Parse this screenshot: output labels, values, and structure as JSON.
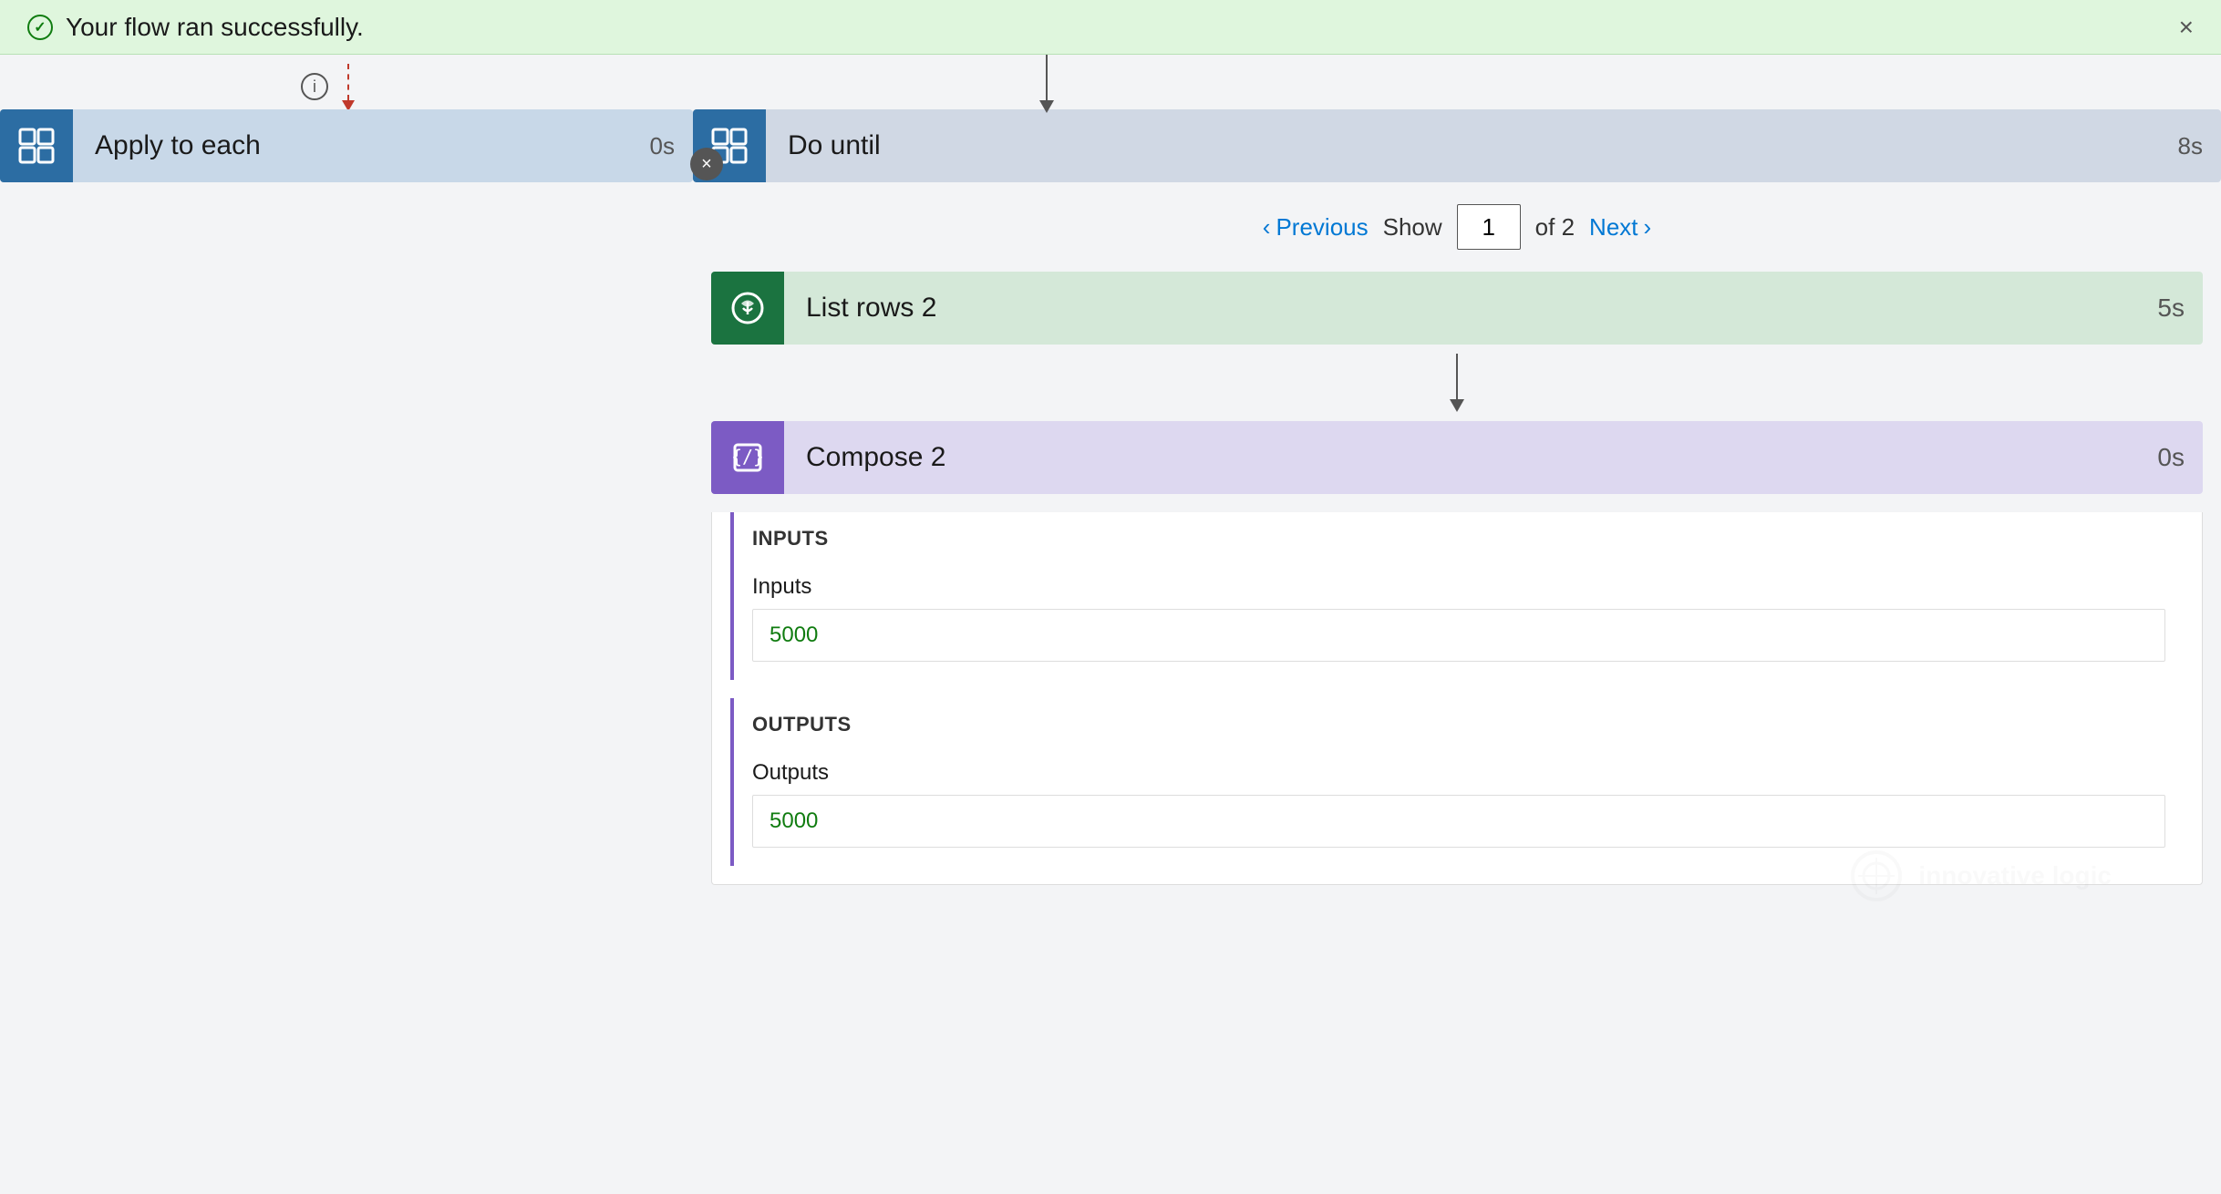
{
  "banner": {
    "message": "Your flow ran successfully.",
    "close_label": "×"
  },
  "left_panel": {
    "step": {
      "name": "Apply to each",
      "duration": "0s",
      "icon_color": "#2c6da3"
    }
  },
  "right_panel": {
    "step": {
      "name": "Do until",
      "duration": "8s",
      "icon_color": "#2c6da3"
    },
    "pagination": {
      "previous_label": "Previous",
      "current_page": "1",
      "of_text": "of 2",
      "next_label": "Next",
      "show_label": "Show"
    },
    "list_rows": {
      "name": "List rows 2",
      "duration": "5s"
    },
    "compose": {
      "name": "Compose 2",
      "duration": "0s",
      "inputs_section": "INPUTS",
      "inputs_label": "Inputs",
      "inputs_value": "5000",
      "outputs_section": "OUTPUTS",
      "outputs_label": "Outputs",
      "outputs_value": "5000"
    }
  },
  "watermark": {
    "company": "innovative logic"
  }
}
